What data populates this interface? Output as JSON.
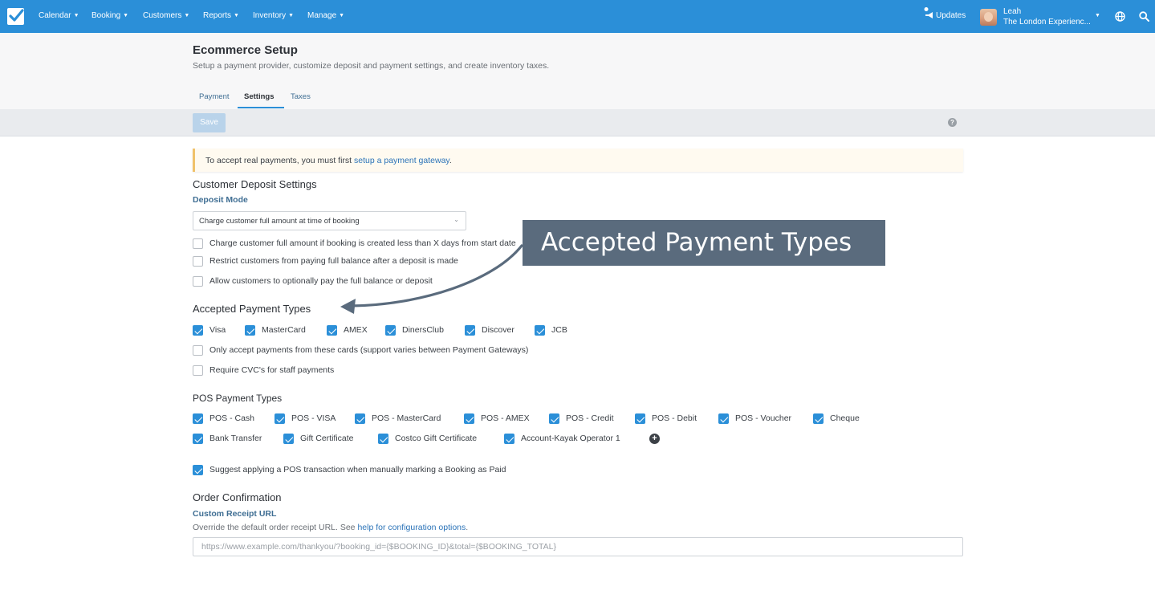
{
  "nav": {
    "items": [
      {
        "label": "Calendar"
      },
      {
        "label": "Booking"
      },
      {
        "label": "Customers"
      },
      {
        "label": "Reports"
      },
      {
        "label": "Inventory"
      },
      {
        "label": "Manage"
      }
    ],
    "updates_label": "Updates",
    "user_name": "Leah",
    "user_company": "The London Experienc...",
    "icons": [
      "checkmark-logo-icon",
      "megaphone-icon",
      "globe-icon",
      "search-icon"
    ]
  },
  "header": {
    "title": "Ecommerce Setup",
    "subtitle": "Setup a payment provider, customize deposit and payment settings, and create inventory taxes.",
    "tabs": [
      {
        "label": "Payment",
        "active": false
      },
      {
        "label": "Settings",
        "active": true
      },
      {
        "label": "Taxes",
        "active": false
      }
    ]
  },
  "toolbar": {
    "save_label": "Save",
    "help_glyph": "?"
  },
  "alert": {
    "text": "To accept real payments, you must first ",
    "link": "setup a payment gateway",
    "suffix": "."
  },
  "deposit": {
    "title": "Customer Deposit Settings",
    "mode_label": "Deposit Mode",
    "mode_value": "Charge customer full amount at time of booking",
    "options": [
      {
        "label": "Charge customer full amount if booking is created less than X days from start date",
        "checked": false
      },
      {
        "label": "Restrict customers from paying full balance after a deposit is made",
        "checked": false
      },
      {
        "label": "Allow customers to optionally pay the full balance or deposit",
        "checked": false
      }
    ]
  },
  "accepted": {
    "title": "Accepted Payment Types",
    "cards": [
      {
        "label": "Visa",
        "checked": true
      },
      {
        "label": "MasterCard",
        "checked": true
      },
      {
        "label": "AMEX",
        "checked": true
      },
      {
        "label": "DinersClub",
        "checked": true
      },
      {
        "label": "Discover",
        "checked": true
      },
      {
        "label": "JCB",
        "checked": true
      }
    ],
    "only_accept": {
      "label": "Only accept payments from these cards (support varies between Payment Gateways)",
      "checked": false
    },
    "require_cvc": {
      "label": "Require CVC's for staff payments",
      "checked": false
    }
  },
  "pos": {
    "title": "POS Payment Types",
    "row1": [
      {
        "label": "POS - Cash",
        "checked": true
      },
      {
        "label": "POS - VISA",
        "checked": true
      },
      {
        "label": "POS - MasterCard",
        "checked": true
      },
      {
        "label": "POS - AMEX",
        "checked": true
      },
      {
        "label": "POS - Credit",
        "checked": true
      },
      {
        "label": "POS - Debit",
        "checked": true
      },
      {
        "label": "POS - Voucher",
        "checked": true
      },
      {
        "label": "Cheque",
        "checked": true
      }
    ],
    "row2": [
      {
        "label": "Bank Transfer",
        "checked": true
      },
      {
        "label": "Gift Certificate",
        "checked": true
      },
      {
        "label": "Costco Gift Certificate",
        "checked": true
      },
      {
        "label": "Account-Kayak Operator 1",
        "checked": true
      }
    ],
    "add_glyph": "+",
    "suggest": {
      "label": "Suggest applying a POS transaction when manually marking a Booking as Paid",
      "checked": true
    }
  },
  "order": {
    "title": "Order Confirmation",
    "receipt_label": "Custom Receipt URL",
    "help_prefix": "Override the default order receipt URL. See ",
    "help_link": "help for configuration options",
    "help_suffix": ".",
    "url_placeholder": "https://www.example.com/thankyou/?booking_id={$BOOKING_ID}&total={$BOOKING_TOTAL}",
    "url_value": ""
  },
  "annotation": {
    "text": "Accepted Payment Types"
  },
  "colors": {
    "nav": "#2b8fd8",
    "checkbox": "#2b8fd8",
    "link": "#2b73b8",
    "callout": "#5a6b7d",
    "alert_border": "#f0c26b"
  }
}
